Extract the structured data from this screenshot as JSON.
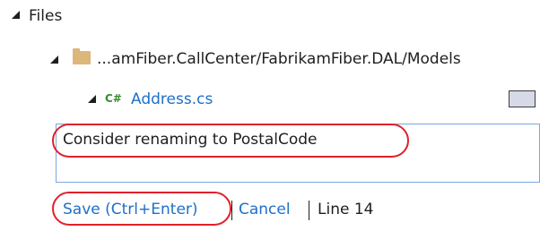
{
  "tree": {
    "root": {
      "label": "Files"
    },
    "folder": {
      "path": "...amFiber.CallCenter/FabrikamFiber.DAL/Models"
    },
    "file": {
      "language_badge": "C#",
      "name": "Address.cs"
    }
  },
  "comment": {
    "value": "Consider renaming to PostalCode"
  },
  "actions": {
    "save_label": "Save (Ctrl+Enter)",
    "cancel_label": "Cancel",
    "line_label": "Line 14"
  },
  "colors": {
    "link": "#1e6fc8",
    "highlight": "#e2202a",
    "folder": "#dcb67a",
    "csharp_badge": "#388a34",
    "input_border": "#7aa7de"
  },
  "icons": {
    "expander": "expanded-triangle-icon",
    "folder": "folder-icon",
    "file": "csharp-file-icon"
  }
}
